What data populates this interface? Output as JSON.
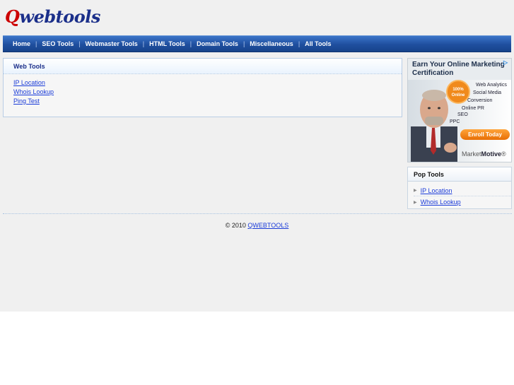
{
  "logo": {
    "first": "Q",
    "rest": "webtools"
  },
  "nav": {
    "items": [
      {
        "label": "Home"
      },
      {
        "label": "SEO Tools"
      },
      {
        "label": "Webmaster Tools"
      },
      {
        "label": "HTML Tools"
      },
      {
        "label": "Domain Tools"
      },
      {
        "label": "Miscellaneous"
      },
      {
        "label": "All Tools"
      }
    ],
    "separator": "|"
  },
  "web_tools": {
    "title": "Web Tools",
    "items": [
      {
        "label": "IP Location"
      },
      {
        "label": "Whois Lookup"
      },
      {
        "label": "Ping Test"
      }
    ]
  },
  "ad": {
    "headline": "Earn Your Online Marketing Certification",
    "badge": "100% Online",
    "keywords": [
      "Web Analytics",
      "Social Media",
      "Conversion",
      "Online PR",
      "SEO",
      "PPC"
    ],
    "enroll": "Enroll Today",
    "brand_a": "Market",
    "brand_b": "Motive",
    "brand_mark": "®",
    "corner_icon": "adchoices-icon",
    "accent": "#f08a1c"
  },
  "pop_tools": {
    "title": "Pop Tools",
    "items": [
      {
        "label": "IP Location"
      },
      {
        "label": "Whois Lookup"
      }
    ]
  },
  "footer": {
    "copyright": "© 2010",
    "link": "QWEBTOOLS"
  },
  "colors": {
    "nav_blue": "#1f4f9f",
    "link_blue": "#1a3bd8",
    "logo_red": "#cc0000",
    "logo_blue": "#1b2f8a",
    "page_bg": "#f0f0f0"
  }
}
